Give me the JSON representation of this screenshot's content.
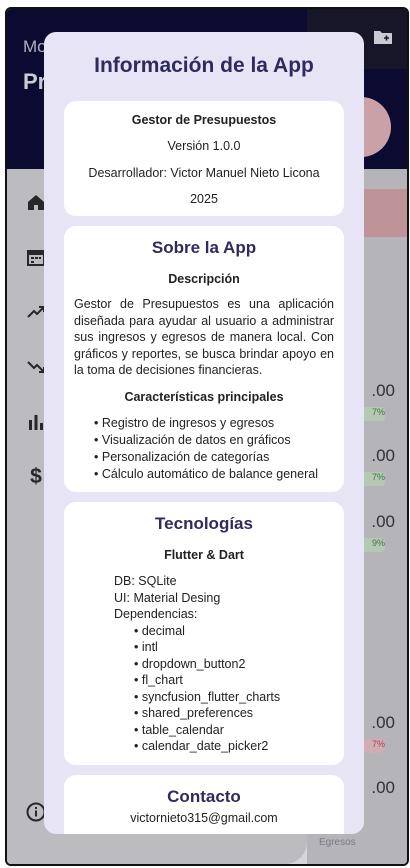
{
  "background": {
    "header_line1": "Mo",
    "header_line2": "Pr",
    "amounts": [
      ".00",
      ".00",
      ".00",
      ".00",
      ".00"
    ],
    "chips": [
      "7%",
      "7%",
      "9%",
      "7%"
    ],
    "bottom_label": "Egresos",
    "nav_icons": [
      "home-icon",
      "calendar-icon",
      "trending-up-icon",
      "trending-down-icon",
      "bar-chart-icon",
      "dollar-icon",
      "info-icon"
    ]
  },
  "dialog": {
    "title": "Información de la App",
    "app_card": {
      "name": "Gestor de Presupuestos",
      "version": "Versión 1.0.0",
      "developer": "Desarrollador: Victor Manuel Nieto Licona",
      "year": "2025"
    },
    "about_card": {
      "heading": "Sobre la App",
      "desc_heading": "Descripción",
      "description": "Gestor de Presupuestos es una aplicación diseñada para ayudar al usuario a administrar sus ingresos y egresos de manera local. Con gráficos y reportes, se busca brindar apoyo en la toma de decisiones financieras.",
      "features_heading": "Características principales",
      "features": [
        "Registro de ingresos y egresos",
        "Visualización de datos en gráficos",
        "Personalización de categorías",
        "Cálculo automático de balance general"
      ]
    },
    "tech_card": {
      "heading": "Tecnologías",
      "stack": "Flutter & Dart",
      "db": "DB: SQLite",
      "ui": "UI: Material Desing",
      "deps_label": "Dependencias:",
      "deps": [
        "decimal",
        "intl",
        "dropdown_button2",
        "fl_chart",
        "syncfusion_flutter_charts",
        "shared_preferences",
        "table_calendar",
        "calendar_date_picker2"
      ]
    },
    "contact_card": {
      "heading": "Contacto",
      "email": "victornieto315@gmail.com"
    }
  },
  "colors": {
    "dialog_bg": "#e7e5f5",
    "heading": "#2f2b5e",
    "header_bg": "#0d0d3a"
  }
}
